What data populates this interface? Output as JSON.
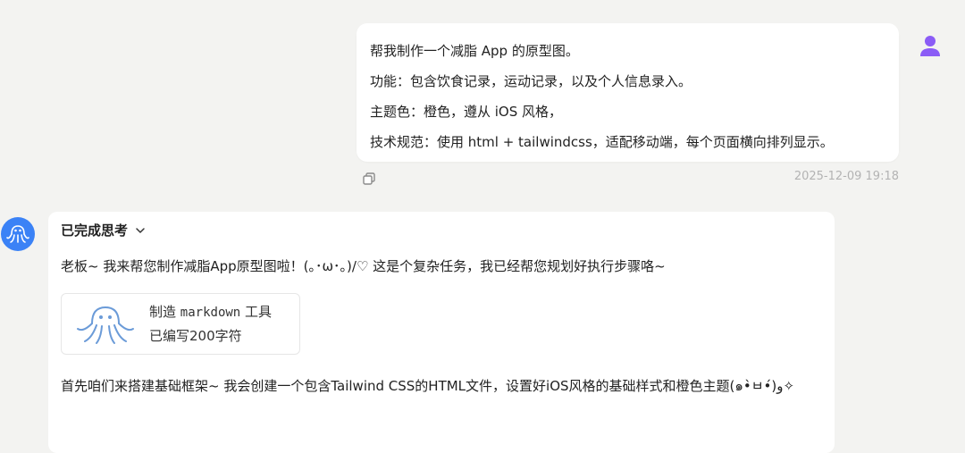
{
  "user_message": {
    "lines": [
      "帮我制作一个减脂 App 的原型图。",
      "功能：包含饮食记录，运动记录，以及个人信息录入。",
      "主题色：橙色，遵从 iOS 风格，",
      "技术规范：使用 html + tailwindcss，适配移动端，每个页面横向排列显示。"
    ],
    "timestamp": "2025-12-09 19:18"
  },
  "assistant": {
    "thinking_label": "已完成思考",
    "intro": "老板~ 我来帮您制作减脂App原型图啦！(｡･ω･｡)/♡ 这是个复杂任务，我已经帮您规划好执行步骤咯~",
    "tool": {
      "prefix": "制造",
      "name": "markdown",
      "suffix": "工具",
      "status": "已编写200字符"
    },
    "paragraph": "首先咱们来搭建基础框架~ 我会创建一个包含Tailwind CSS的HTML文件，设置好iOS风格的基础样式和橙色主题(๑•̀ㅂ•́)و✧"
  },
  "colors": {
    "user_avatar": "#8b5cf6",
    "bot_avatar": "#3b82f6",
    "octopus_outline": "#6b9bd8"
  },
  "icons": [
    "user-avatar-icon",
    "copy-icon",
    "octopus-icon",
    "chevron-down-icon"
  ]
}
